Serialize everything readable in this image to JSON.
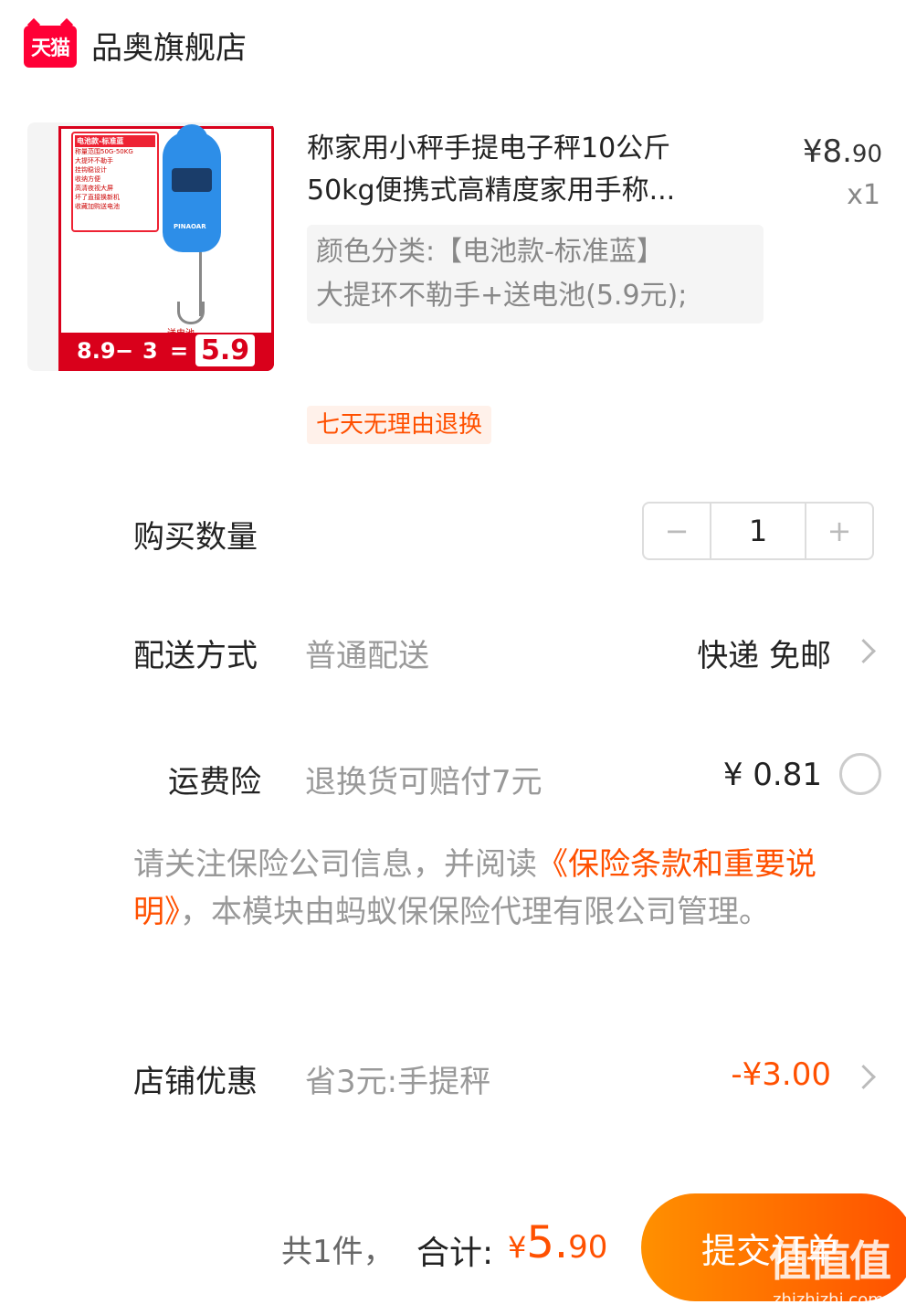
{
  "header": {
    "brand_logo_text": "天猫",
    "shop_name": "品奥旗舰店"
  },
  "product": {
    "title_line1": "称家用小秤手提电子秤10公斤",
    "title_line2": "50kg便携式高精度家用手称...",
    "price_currency": "¥",
    "price_int": "8.",
    "price_dec": "90",
    "quantity_label": "x1",
    "sku_line1": "颜色分类:【电池款-标准蓝】",
    "sku_line2": "大提环不勒手+送电池(5.9元);",
    "return_tag": "七天无理由退换",
    "image_text": {
      "card_header": "电池款-标准蓝",
      "card_items": [
        "称量范围50G-50KG",
        "大提环不勒手",
        "挂钩稳设计",
        "收纳方便",
        "高清夜视大屏",
        "坏了直接换新机",
        "收藏加购送电池"
      ],
      "brand": "PINAOAR",
      "promo_gift": "送电池",
      "bar_a": "8.9",
      "bar_b": "3",
      "bar_c": "5.9"
    }
  },
  "purchase_qty": {
    "label": "购买数量",
    "minus": "−",
    "value": "1",
    "plus": "+"
  },
  "delivery": {
    "label": "配送方式",
    "value": "普通配送",
    "right": "快递 免邮"
  },
  "freight_insurance": {
    "label": "运费险",
    "desc": "退换货可赔付7元",
    "price": "¥ 0.81"
  },
  "notice": {
    "prefix": "请关注保险公司信息，并阅读",
    "link": "《保险条款和重要说明》",
    "suffix": "，本模块由蚂蚁保保险代理有限公司管理。"
  },
  "store_discount": {
    "label": "店铺优惠",
    "desc": "省3元:手提秤",
    "amount": "-¥3.00"
  },
  "footer": {
    "count": "共1件，",
    "total_label": "合计:",
    "total_currency": "¥",
    "total_int": "5.",
    "total_dec": "90",
    "submit": "提交订单",
    "watermark": "值值值",
    "watermark_url": "zhizhizhi.com"
  },
  "colors": {
    "accent": "#ff5000",
    "tmall_red": "#ff0036",
    "muted": "#999999"
  }
}
